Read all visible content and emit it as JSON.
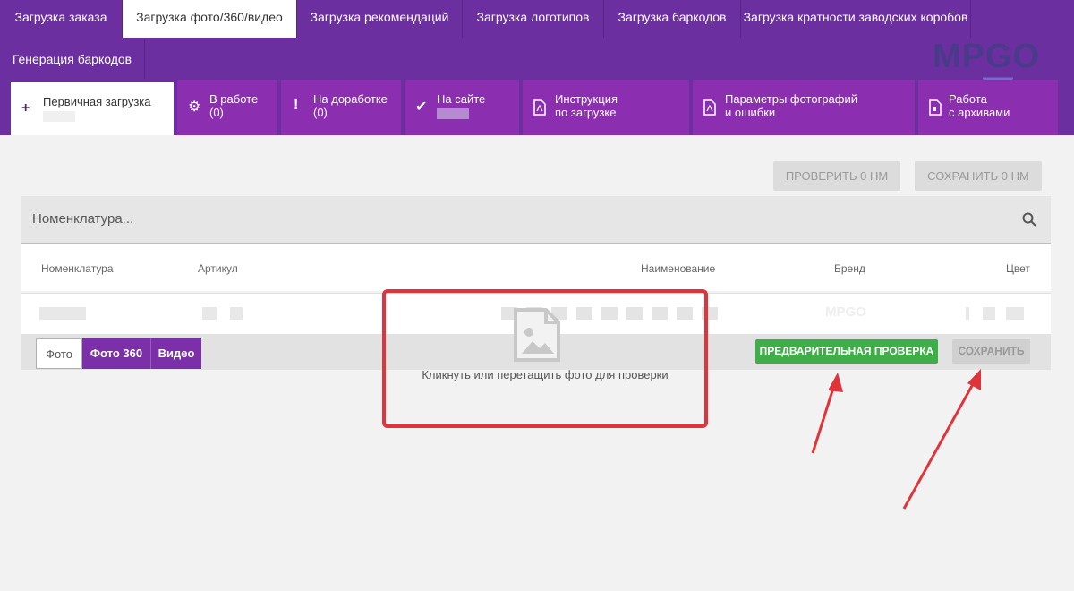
{
  "topnav": {
    "tabs": [
      {
        "label": "Загрузка заказа"
      },
      {
        "label": "Загрузка фото/360/видео"
      },
      {
        "label": "Загрузка рекомендаций"
      },
      {
        "label": "Загрузка логотипов"
      },
      {
        "label": "Загрузка баркодов"
      },
      {
        "label": "Загрузка кратности заводских коробов"
      }
    ],
    "row2_label": "Генерация баркодов",
    "logo_text": "MPGO"
  },
  "subnav": {
    "tabs": [
      {
        "label": "Первичная загрузка",
        "icon": "plus-icon"
      },
      {
        "line1": "В работе",
        "line2": "(0)",
        "icon": "gear-icon"
      },
      {
        "line1": "На доработке",
        "line2": "(0)",
        "icon": "exclamation-icon"
      },
      {
        "line1": "На сайте",
        "icon": "check-icon"
      },
      {
        "line1": "Инструкция",
        "line2": "по загрузке",
        "icon": "pdf-icon"
      },
      {
        "line1": "Параметры фотографий",
        "line2": "и ошибки",
        "icon": "pdf-icon"
      },
      {
        "line1": "Работа",
        "line2": "с архивами",
        "icon": "archive-icon"
      }
    ]
  },
  "actions": {
    "check_label": "ПРОВЕРИТЬ 0 НМ",
    "save_label": "СОХРАНИТЬ 0 НМ"
  },
  "search": {
    "placeholder": "Номенклатура..."
  },
  "table": {
    "columns": [
      "Номенклатура",
      "Артикул",
      "Наименование",
      "Бренд",
      "Цвет"
    ],
    "brand_value": "MPGO"
  },
  "media": {
    "tabs": [
      "Фото",
      "Фото 360",
      "Видео"
    ],
    "precheck_label": "ПРЕДВАРИТЕЛЬНАЯ ПРОВЕРКА",
    "save_label": "СОХРАНИТЬ",
    "dropzone_text": "Кликнуть или перетащить фото для проверки"
  },
  "colors": {
    "brand_purple": "#6b2fa0",
    "accent_purple": "#8b2fb0",
    "green": "#3fae49",
    "annotation_red": "#e0343a"
  }
}
